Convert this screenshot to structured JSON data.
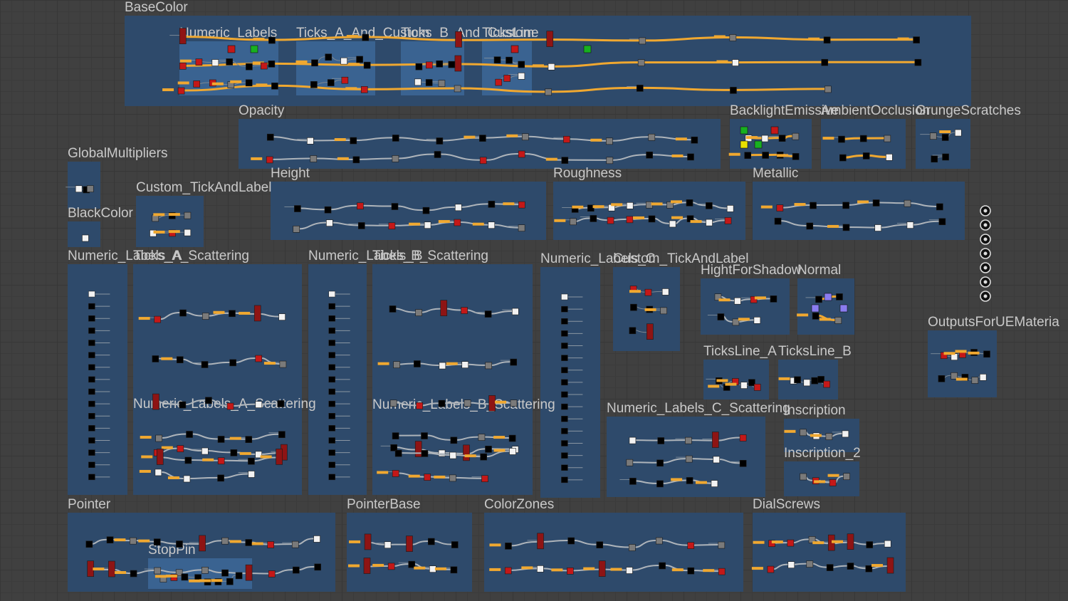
{
  "frames": [
    {
      "id": "basecolor",
      "title": "BaseColor",
      "nodes": 26,
      "flow": "orange"
    },
    {
      "id": "numeric-labels",
      "title": "Numeric_Labels",
      "nodes": 9,
      "flow": "none"
    },
    {
      "id": "ticks-a-and-custom",
      "title": "Ticks_A_And_Custom",
      "nodes": 7,
      "flow": "none"
    },
    {
      "id": "ticks-b-and-custom",
      "title": "Ticks_B_And_Custom",
      "nodes": 7,
      "flow": "none"
    },
    {
      "id": "ticks-line",
      "title": "TicksLine",
      "nodes": 6,
      "flow": "none"
    },
    {
      "id": "opacity",
      "title": "Opacity",
      "nodes": 22,
      "flow": "white"
    },
    {
      "id": "backlight-emissive",
      "title": "BacklightEmissive",
      "nodes": 8,
      "flow": "orange"
    },
    {
      "id": "ambient-occlusion",
      "title": "AmbientOcclusion",
      "nodes": 6,
      "flow": "orange"
    },
    {
      "id": "grunge-scratches",
      "title": "GrungeScratches",
      "nodes": 5,
      "flow": "none"
    },
    {
      "id": "global-multipliers",
      "title": "GlobalMultipliers",
      "nodes": 3,
      "flow": "none"
    },
    {
      "id": "custom-tick-and-label",
      "title": "Custom_TickAndLabel",
      "nodes": 6,
      "flow": "none"
    },
    {
      "id": "blackcolor",
      "title": "BlackColor",
      "nodes": 1,
      "flow": "none"
    },
    {
      "id": "height",
      "title": "Height",
      "nodes": 16,
      "flow": "white"
    },
    {
      "id": "roughness",
      "title": "Roughness",
      "nodes": 18,
      "flow": "white"
    },
    {
      "id": "metallic",
      "title": "Metallic",
      "nodes": 12,
      "flow": "white"
    },
    {
      "id": "numeric-labels-a",
      "title": "Numeric_Labels_A",
      "nodes": 16,
      "flow": "none"
    },
    {
      "id": "ticks-a-scattering",
      "title": "Ticks_A_Scattering",
      "nodes": 24,
      "flow": "white"
    },
    {
      "id": "numeric-labels-b",
      "title": "Numeric_Labels_B",
      "nodes": 16,
      "flow": "none"
    },
    {
      "id": "ticks-b-scattering",
      "title": "Ticks_B_Scattering",
      "nodes": 24,
      "flow": "white"
    },
    {
      "id": "numeric-labels-c",
      "title": "Numeric_Labels_C",
      "nodes": 16,
      "flow": "none"
    },
    {
      "id": "custom-tick-and-label-2",
      "title": "Custom_TickAndLabel",
      "nodes": 8,
      "flow": "none"
    },
    {
      "id": "hight-for-shadow",
      "title": "HightForShadow",
      "nodes": 7,
      "flow": "white"
    },
    {
      "id": "normal",
      "title": "Normal",
      "nodes": 4,
      "flow": "orange"
    },
    {
      "id": "numeric-labels-a-scattering",
      "title": "Numeric_Labels_A_Scattering",
      "nodes": 14,
      "flow": "white"
    },
    {
      "id": "numeric-labels-b-scattering",
      "title": "Numeric_Labels_B_Scattering",
      "nodes": 14,
      "flow": "white"
    },
    {
      "id": "ticksline-a",
      "title": "TicksLine_A",
      "nodes": 6,
      "flow": "none"
    },
    {
      "id": "ticksline-b",
      "title": "TicksLine_B",
      "nodes": 6,
      "flow": "none"
    },
    {
      "id": "numeric-labels-c-scattering",
      "title": "Numeric_Labels_C_Scattering",
      "nodes": 14,
      "flow": "white"
    },
    {
      "id": "inscription",
      "title": "Inscription",
      "nodes": 4,
      "flow": "white"
    },
    {
      "id": "inscription-2",
      "title": "Inscription_2",
      "nodes": 4,
      "flow": "white"
    },
    {
      "id": "outputs-for-ue-material",
      "title": "OutputsForUEMateria",
      "nodes": 10,
      "flow": "none"
    },
    {
      "id": "pointer",
      "title": "Pointer",
      "nodes": 22,
      "flow": "white"
    },
    {
      "id": "stoppin",
      "title": "StopPin",
      "nodes": 8,
      "flow": "none"
    },
    {
      "id": "pointerbase",
      "title": "PointerBase",
      "nodes": 10,
      "flow": "white"
    },
    {
      "id": "colorzones",
      "title": "ColorZones",
      "nodes": 16,
      "flow": "white"
    },
    {
      "id": "dialscrews",
      "title": "DialScrews",
      "nodes": 14,
      "flow": "white"
    }
  ],
  "colors": {
    "canvas": "#404040",
    "frame": "#2e4a6b",
    "frame_inner": "#3a6391",
    "title": "#c9c9c9",
    "wire_white": "#b8bcc0",
    "wire_orange": "#f0a830",
    "node_black": "#000000",
    "node_white": "#f2f2f2",
    "node_red": "#c41818",
    "node_darkred": "#8e1414",
    "node_green": "#18b020",
    "node_gray": "#7a7a7a",
    "node_purple": "#8a7cf0",
    "node_yellow": "#e8e000"
  },
  "output_sockets": {
    "count": 7,
    "icon": "output-socket-icon"
  }
}
